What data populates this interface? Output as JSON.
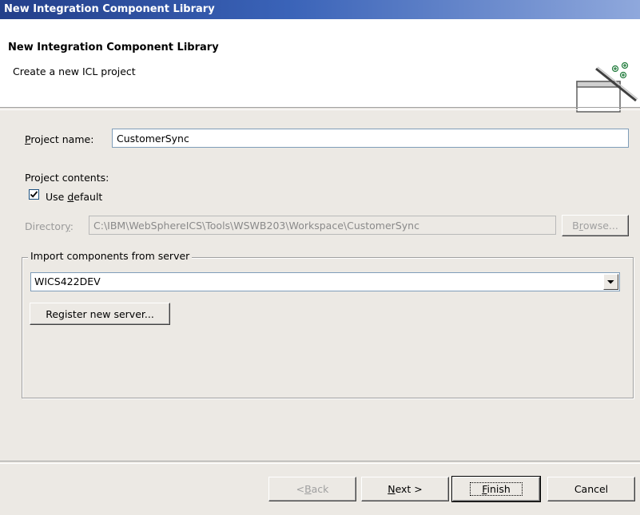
{
  "window": {
    "title": "New Integration Component Library"
  },
  "banner": {
    "title": "New Integration Component Library",
    "subtitle": "Create a  new ICL project",
    "icon": "new-project-wizard-icon"
  },
  "form": {
    "project_name_label_u": "P",
    "project_name_label_rest": "roject name:",
    "project_name_value": "CustomerSync",
    "project_contents_label": "Project contents:",
    "use_default_pre": "Use ",
    "use_default_u": "d",
    "use_default_rest": "efault",
    "use_default_checked": true,
    "directory_label_pre": "Director",
    "directory_label_u": "y",
    "directory_label_rest": ":",
    "directory_value": "C:\\IBM\\WebSphereICS\\Tools\\WSWB203\\Workspace\\CustomerSync",
    "browse_pre": "B",
    "browse_u": "r",
    "browse_rest": "owse..."
  },
  "import_group": {
    "legend": "Import components from server",
    "server_selected": "WICS422DEV",
    "register_button": "Register new server..."
  },
  "footer": {
    "back_pre": "< ",
    "back_u": "B",
    "back_rest": "ack",
    "next_u": "N",
    "next_rest": "ext >",
    "finish_u": "F",
    "finish_rest": "inish",
    "cancel": "Cancel"
  }
}
